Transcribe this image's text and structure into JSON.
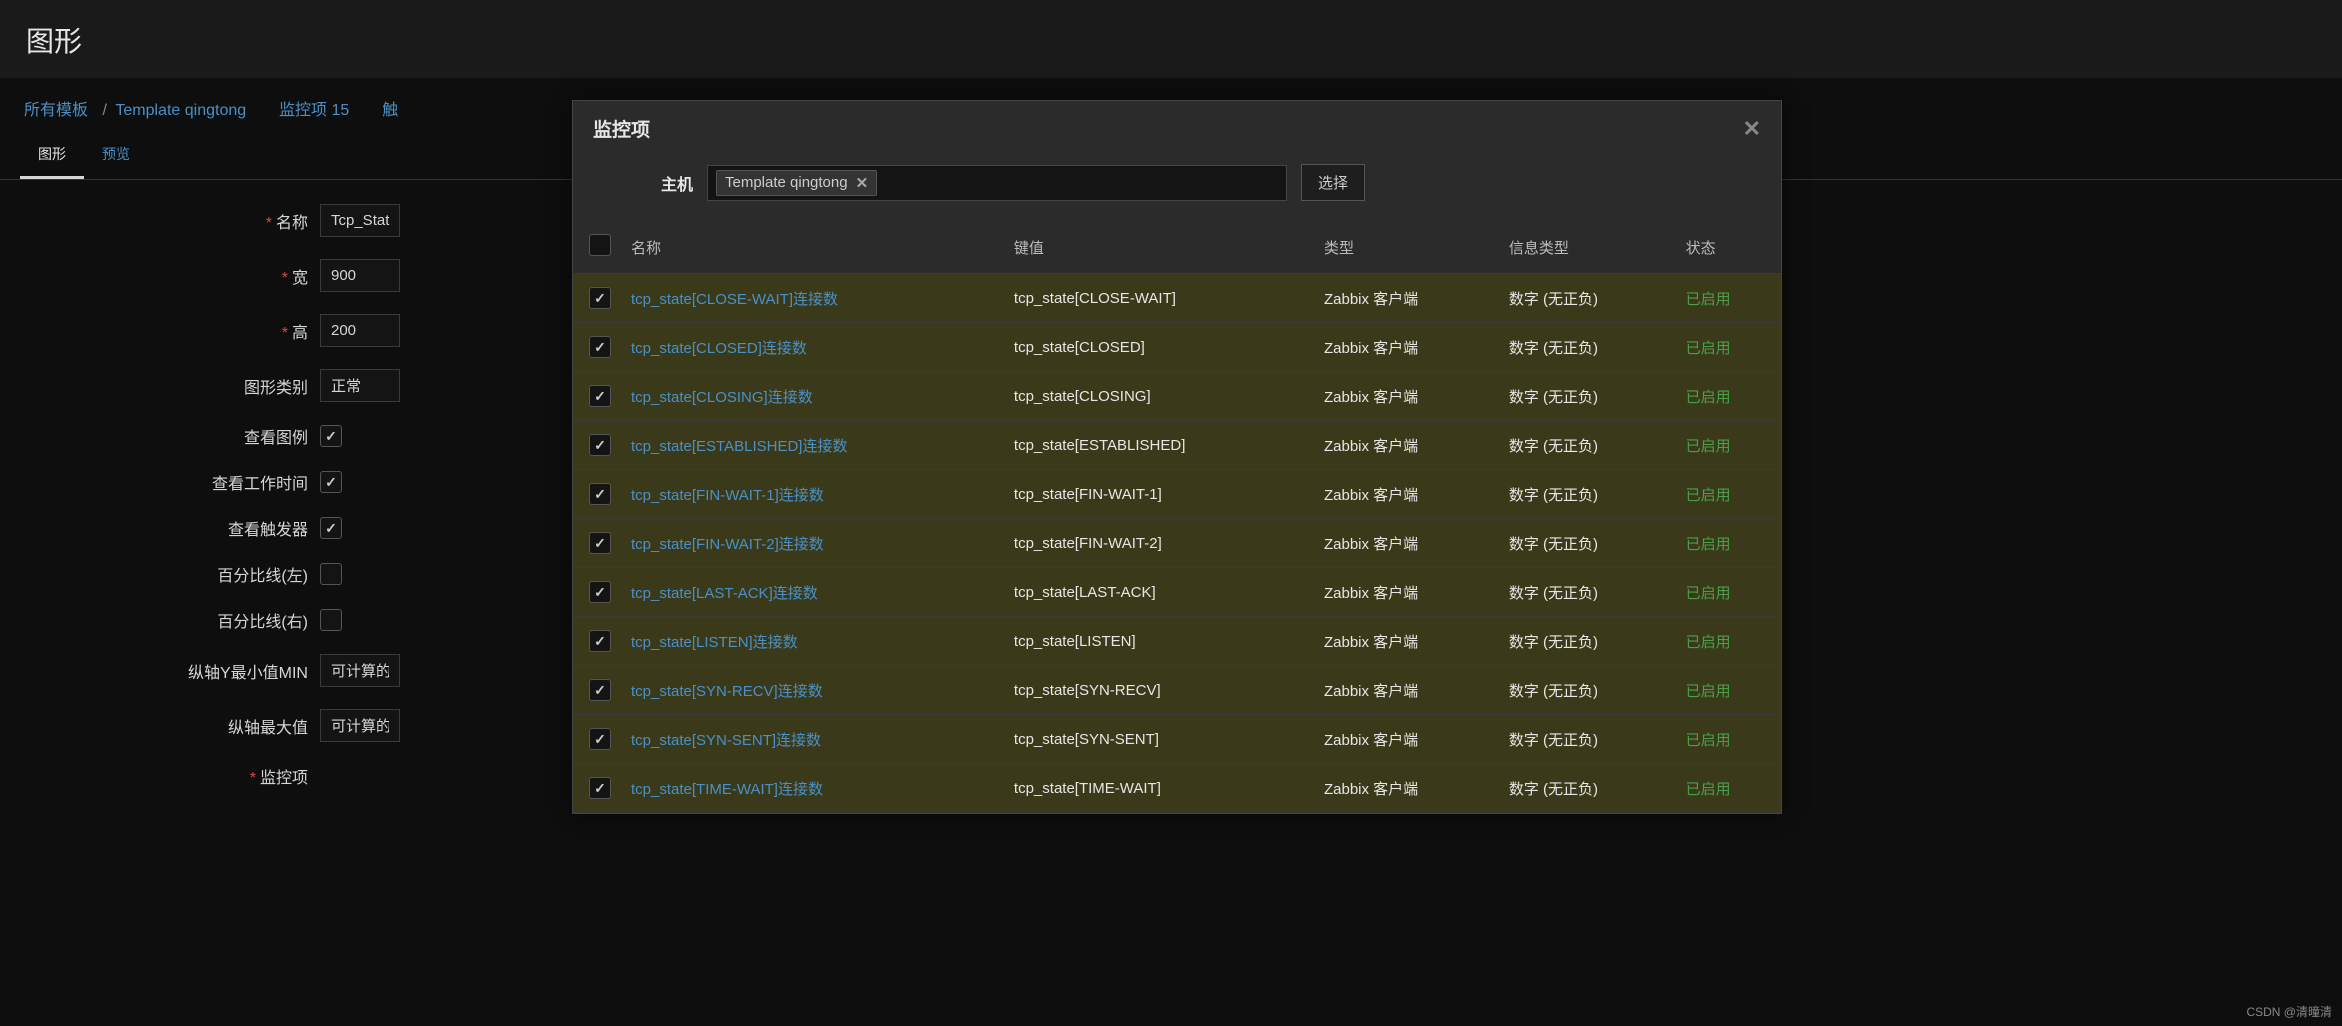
{
  "header": {
    "title": "图形"
  },
  "breadcrumb": {
    "all_templates": "所有模板",
    "template_name": "Template qingtong",
    "items_label": "监控项",
    "items_count": "15",
    "triggers_label": "触"
  },
  "tabs": {
    "graph": "图形",
    "preview": "预览"
  },
  "form": {
    "name_label": "名称",
    "name_value": "Tcp_Stat",
    "width_label": "宽",
    "width_value": "900",
    "height_label": "高",
    "height_value": "200",
    "type_label": "图形类别",
    "type_value": "正常",
    "show_legend_label": "查看图例",
    "show_worktime_label": "查看工作时间",
    "show_triggers_label": "查看触发器",
    "percent_left_label": "百分比线(左)",
    "percent_right_label": "百分比线(右)",
    "ymin_label": "纵轴Y最小值MIN",
    "ymin_value": "可计算的",
    "ymax_label": "纵轴最大值",
    "ymax_value": "可计算的",
    "items_label": "监控项"
  },
  "modal": {
    "title": "监控项",
    "host_label": "主机",
    "host_tag": "Template qingtong",
    "select_btn": "选择",
    "columns": {
      "name": "名称",
      "key": "键值",
      "type": "类型",
      "infotype": "信息类型",
      "status": "状态"
    },
    "rows": [
      {
        "name": "tcp_state[CLOSE-WAIT]连接数",
        "key": "tcp_state[CLOSE-WAIT]",
        "type": "Zabbix 客户端",
        "info": "数字 (无正负)",
        "status": "已启用"
      },
      {
        "name": "tcp_state[CLOSED]连接数",
        "key": "tcp_state[CLOSED]",
        "type": "Zabbix 客户端",
        "info": "数字 (无正负)",
        "status": "已启用"
      },
      {
        "name": "tcp_state[CLOSING]连接数",
        "key": "tcp_state[CLOSING]",
        "type": "Zabbix 客户端",
        "info": "数字 (无正负)",
        "status": "已启用"
      },
      {
        "name": "tcp_state[ESTABLISHED]连接数",
        "key": "tcp_state[ESTABLISHED]",
        "type": "Zabbix 客户端",
        "info": "数字 (无正负)",
        "status": "已启用"
      },
      {
        "name": "tcp_state[FIN-WAIT-1]连接数",
        "key": "tcp_state[FIN-WAIT-1]",
        "type": "Zabbix 客户端",
        "info": "数字 (无正负)",
        "status": "已启用"
      },
      {
        "name": "tcp_state[FIN-WAIT-2]连接数",
        "key": "tcp_state[FIN-WAIT-2]",
        "type": "Zabbix 客户端",
        "info": "数字 (无正负)",
        "status": "已启用"
      },
      {
        "name": "tcp_state[LAST-ACK]连接数",
        "key": "tcp_state[LAST-ACK]",
        "type": "Zabbix 客户端",
        "info": "数字 (无正负)",
        "status": "已启用"
      },
      {
        "name": "tcp_state[LISTEN]连接数",
        "key": "tcp_state[LISTEN]",
        "type": "Zabbix 客户端",
        "info": "数字 (无正负)",
        "status": "已启用"
      },
      {
        "name": "tcp_state[SYN-RECV]连接数",
        "key": "tcp_state[SYN-RECV]",
        "type": "Zabbix 客户端",
        "info": "数字 (无正负)",
        "status": "已启用"
      },
      {
        "name": "tcp_state[SYN-SENT]连接数",
        "key": "tcp_state[SYN-SENT]",
        "type": "Zabbix 客户端",
        "info": "数字 (无正负)",
        "status": "已启用"
      },
      {
        "name": "tcp_state[TIME-WAIT]连接数",
        "key": "tcp_state[TIME-WAIT]",
        "type": "Zabbix 客户端",
        "info": "数字 (无正负)",
        "status": "已启用"
      }
    ]
  },
  "watermark": "CSDN @清曈清"
}
